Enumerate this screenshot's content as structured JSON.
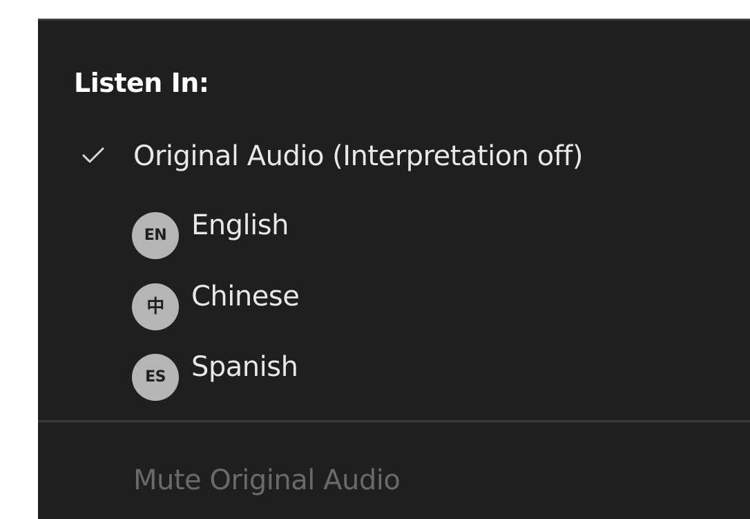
{
  "listen_menu": {
    "heading": "Listen In:",
    "items": [
      {
        "label": "Original Audio (Interpretation off)",
        "checked": true,
        "icon": "checkmark-icon"
      },
      {
        "label": "English",
        "badge": "EN",
        "icon": "english-language-badge-icon"
      },
      {
        "label": "Chinese",
        "badge": "中",
        "icon": "chinese-language-badge-icon"
      },
      {
        "label": "Spanish",
        "badge": "ES",
        "icon": "spanish-language-badge-icon"
      }
    ],
    "mute_label": "Mute Original Audio",
    "mute_enabled": false
  },
  "colors": {
    "panel_bg": "#1f1f1f",
    "divider": "#3a3a3a",
    "text": "#e8e8e8",
    "heading": "#ffffff",
    "disabled_text": "#6a6a6a",
    "badge_bg": "#b5b5b5"
  }
}
